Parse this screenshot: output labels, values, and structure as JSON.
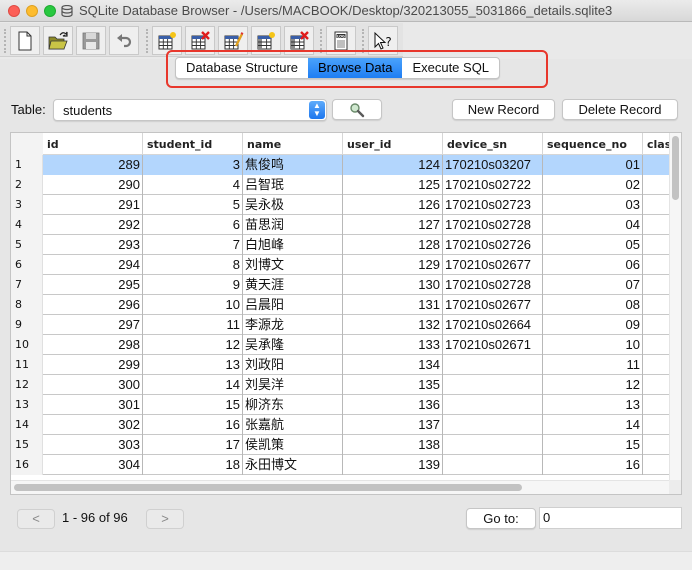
{
  "window": {
    "title": "SQLite Database Browser - /Users/MACBOOK/Desktop/320213055_5031866_details.sqlite3"
  },
  "toolbar": {
    "buttons": [
      {
        "icon": "new-document-icon"
      },
      {
        "icon": "open-folder-icon"
      },
      {
        "icon": "save-disk-icon"
      },
      {
        "icon": "undo-icon"
      },
      {
        "icon": "create-table-icon"
      },
      {
        "icon": "delete-table-icon"
      },
      {
        "icon": "modify-table-icon"
      },
      {
        "icon": "create-index-icon"
      },
      {
        "icon": "delete-index-icon"
      },
      {
        "icon": "log-icon"
      },
      {
        "icon": "whats-this-help-icon"
      }
    ]
  },
  "tabs": [
    {
      "label": "Database Structure",
      "active": false
    },
    {
      "label": "Browse Data",
      "active": true
    },
    {
      "label": "Execute SQL",
      "active": false
    }
  ],
  "table_selector": {
    "label": "Table:",
    "value": "students"
  },
  "actions": {
    "new_record": "New Record",
    "delete_record": "Delete Record"
  },
  "grid": {
    "columns": [
      "id",
      "student_id",
      "name",
      "user_id",
      "device_sn",
      "sequence_no",
      "clas"
    ],
    "selected_row": 1,
    "rows": [
      {
        "n": "1",
        "id": "289",
        "student_id": "3",
        "name": "焦俊鸣",
        "user_id": "124",
        "device_sn": "170210s03207",
        "sequence_no": "01",
        "clas": ""
      },
      {
        "n": "2",
        "id": "290",
        "student_id": "4",
        "name": "吕智珉",
        "user_id": "125",
        "device_sn": "170210s02722",
        "sequence_no": "02",
        "clas": ""
      },
      {
        "n": "3",
        "id": "291",
        "student_id": "5",
        "name": "吴永极",
        "user_id": "126",
        "device_sn": "170210s02723",
        "sequence_no": "03",
        "clas": ""
      },
      {
        "n": "4",
        "id": "292",
        "student_id": "6",
        "name": "苗思润",
        "user_id": "127",
        "device_sn": "170210s02728",
        "sequence_no": "04",
        "clas": ""
      },
      {
        "n": "5",
        "id": "293",
        "student_id": "7",
        "name": "白旭峰",
        "user_id": "128",
        "device_sn": "170210s02726",
        "sequence_no": "05",
        "clas": ""
      },
      {
        "n": "6",
        "id": "294",
        "student_id": "8",
        "name": "刘博文",
        "user_id": "129",
        "device_sn": "170210s02677",
        "sequence_no": "06",
        "clas": ""
      },
      {
        "n": "7",
        "id": "295",
        "student_id": "9",
        "name": "黄天涯",
        "user_id": "130",
        "device_sn": "170210s02728",
        "sequence_no": "07",
        "clas": ""
      },
      {
        "n": "8",
        "id": "296",
        "student_id": "10",
        "name": "吕晨阳",
        "user_id": "131",
        "device_sn": "170210s02677",
        "sequence_no": "08",
        "clas": ""
      },
      {
        "n": "9",
        "id": "297",
        "student_id": "11",
        "name": "李源龙",
        "user_id": "132",
        "device_sn": "170210s02664",
        "sequence_no": "09",
        "clas": ""
      },
      {
        "n": "10",
        "id": "298",
        "student_id": "12",
        "name": "吴承隆",
        "user_id": "133",
        "device_sn": "170210s02671",
        "sequence_no": "10",
        "clas": ""
      },
      {
        "n": "11",
        "id": "299",
        "student_id": "13",
        "name": "刘政阳",
        "user_id": "134",
        "device_sn": "",
        "sequence_no": "11",
        "clas": ""
      },
      {
        "n": "12",
        "id": "300",
        "student_id": "14",
        "name": "刘昊洋",
        "user_id": "135",
        "device_sn": "",
        "sequence_no": "12",
        "clas": ""
      },
      {
        "n": "13",
        "id": "301",
        "student_id": "15",
        "name": "柳济东",
        "user_id": "136",
        "device_sn": "",
        "sequence_no": "13",
        "clas": ""
      },
      {
        "n": "14",
        "id": "302",
        "student_id": "16",
        "name": "张嘉航",
        "user_id": "137",
        "device_sn": "",
        "sequence_no": "14",
        "clas": ""
      },
      {
        "n": "15",
        "id": "303",
        "student_id": "17",
        "name": "侯凯策",
        "user_id": "138",
        "device_sn": "",
        "sequence_no": "15",
        "clas": ""
      },
      {
        "n": "16",
        "id": "304",
        "student_id": "18",
        "name": "永田博文",
        "user_id": "139",
        "device_sn": "",
        "sequence_no": "16",
        "clas": ""
      }
    ]
  },
  "pager": {
    "prev": "<",
    "next": ">",
    "range_text": "1 - 96 of 96",
    "goto_label": "Go to:",
    "goto_value": "0"
  },
  "colors": {
    "active_tab": "#1f7ef3",
    "selected_row": "#b3d6fd",
    "highlight_box": "#e8372c"
  }
}
